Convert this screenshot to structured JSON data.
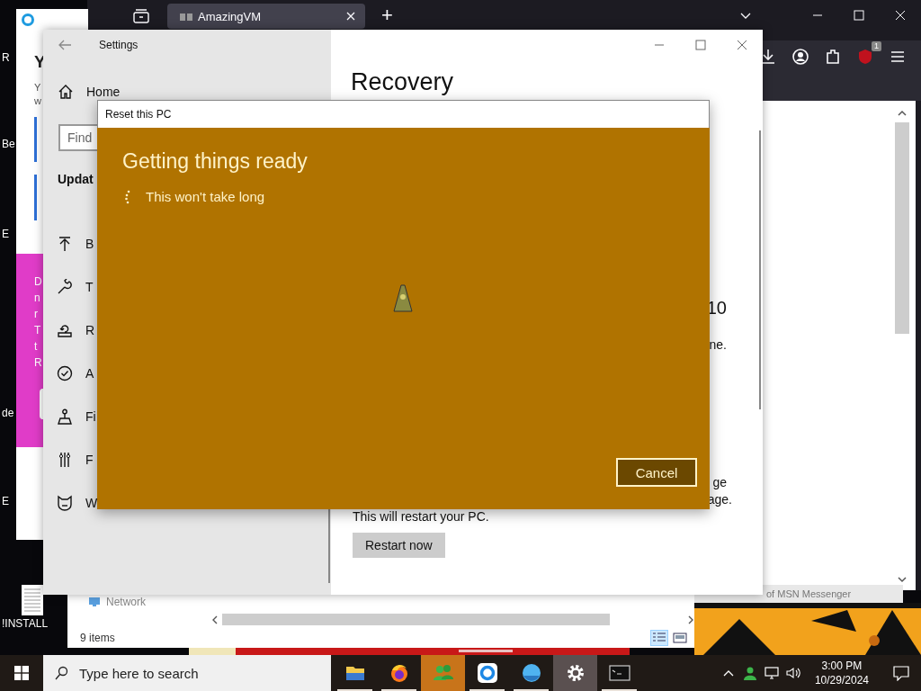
{
  "desktop": {
    "icons": [
      {
        "label": "R"
      },
      {
        "label": "Be"
      },
      {
        "label": "E"
      },
      {
        "label": "de"
      },
      {
        "label": "E"
      },
      {
        "label": "!INSTALL"
      }
    ]
  },
  "browser": {
    "tabs": [
      {
        "title": "AmazingVM"
      }
    ],
    "new_tab": "+",
    "extension_badge": "1"
  },
  "side_app": {
    "heading": "Y",
    "text_lines": [
      "Y",
      "w"
    ],
    "promo_lines": [
      "D",
      "n",
      "r",
      "T",
      "t",
      "R"
    ]
  },
  "file_explorer": {
    "items": [
      "Network"
    ],
    "status": "9 items",
    "view_modes": [
      {
        "selected": true
      },
      {
        "selected": false
      }
    ]
  },
  "messenger_window": {
    "text": "of MSN Messenger"
  },
  "settings": {
    "window_title": "Settings",
    "home": "Home",
    "search_placeholder": "Find",
    "section": "Updat",
    "nav_items": [
      {
        "kind": "backup",
        "label": "B"
      },
      {
        "kind": "troubleshoot",
        "label": "T"
      },
      {
        "kind": "recovery",
        "label": "R"
      },
      {
        "kind": "activation",
        "label": "A"
      },
      {
        "kind": "find",
        "label": "Fi"
      },
      {
        "kind": "developers",
        "label": "F"
      },
      {
        "kind": "insider",
        "label": "W"
      }
    ],
    "page_title": "Recovery",
    "fragments": [
      "10",
      "ne.",
      "ge",
      "age."
    ],
    "restart_note": "This will restart your PC.",
    "restart_button": "Restart now"
  },
  "dialog": {
    "title": "Reset this PC",
    "heading": "Getting things ready",
    "status": "This won't take long",
    "cancel": "Cancel"
  },
  "taskbar": {
    "search_placeholder": "Type here to search",
    "apps": [
      {
        "kind": "folder",
        "running": true,
        "selected": false,
        "flashing": false
      },
      {
        "kind": "firefox",
        "running": true,
        "selected": false,
        "flashing": false
      },
      {
        "kind": "messenger",
        "running": false,
        "selected": false,
        "flashing": true
      },
      {
        "kind": "ring",
        "running": true,
        "selected": false,
        "flashing": false
      },
      {
        "kind": "globe",
        "running": true,
        "selected": false,
        "flashing": false
      },
      {
        "kind": "gear",
        "running": false,
        "selected": true,
        "flashing": false
      },
      {
        "kind": "terminal",
        "running": true,
        "selected": false,
        "flashing": false
      }
    ],
    "time": "3:00 PM",
    "date": "10/29/2024"
  }
}
